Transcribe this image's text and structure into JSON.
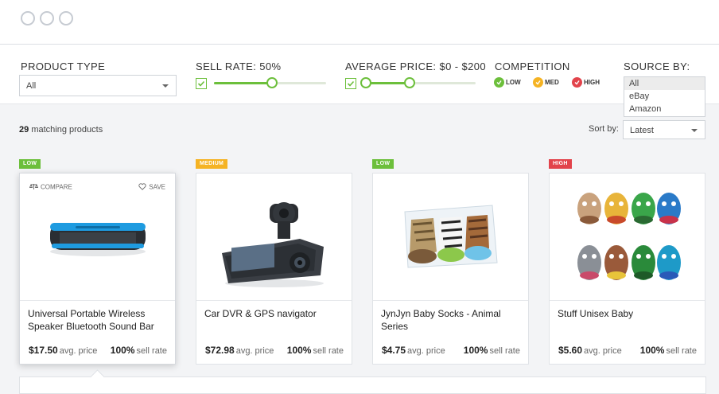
{
  "window": {
    "controls": [
      "circle",
      "circle",
      "circle"
    ]
  },
  "filters": {
    "product_type": {
      "label": "PRODUCT TYPE",
      "value": "All"
    },
    "sell_rate": {
      "label": "SELL RATE:",
      "value": "50%",
      "enabled": true,
      "level_percent": 50
    },
    "average_price": {
      "label": "AVERAGE PRICE:",
      "value": "$0 - $200",
      "enabled": true
    },
    "competition": {
      "label": "COMPETITION",
      "levels": [
        {
          "label": "LOW",
          "color": "#6cbf3b"
        },
        {
          "label": "MED",
          "color": "#f5b323"
        },
        {
          "label": "HIGH",
          "color": "#e2434b"
        }
      ]
    },
    "source_by": {
      "label": "SOURCE BY:",
      "options": [
        "All",
        "eBay",
        "Amazon"
      ],
      "selected": "All"
    }
  },
  "results": {
    "count": "29",
    "count_suffix": "matching products",
    "sort_label": "Sort by:",
    "sort_value": "Latest"
  },
  "card_actions": {
    "compare": "COMPARE",
    "save": "SAVE"
  },
  "products": [
    {
      "badge": "LOW",
      "badge_color": "#6cbf3b",
      "title": "Universal Portable Wireless Speaker Bluetooth Sound Bar",
      "price": "$17.50",
      "price_label": "avg. price",
      "rate": "100%",
      "rate_label": "sell rate",
      "image_icon": "speaker-image"
    },
    {
      "badge": "MEDIUM",
      "badge_color": "#f5b323",
      "title": "Car DVR & GPS navigator",
      "price": "$72.98",
      "price_label": "avg. price",
      "rate": "100%",
      "rate_label": "sell rate",
      "image_icon": "dashcam-image"
    },
    {
      "badge": "LOW",
      "badge_color": "#6cbf3b",
      "title": "JynJyn Baby Socks - Animal Series",
      "price": "$4.75",
      "price_label": "avg. price",
      "rate": "100%",
      "rate_label": "sell rate",
      "image_icon": "baby-socks-image"
    },
    {
      "badge": "HIGH",
      "badge_color": "#e2434b",
      "title": "Stuff Unisex Baby",
      "price": "$5.60",
      "price_label": "avg. price",
      "rate": "100%",
      "rate_label": "sell rate",
      "image_icon": "baby-shoes-image"
    }
  ]
}
